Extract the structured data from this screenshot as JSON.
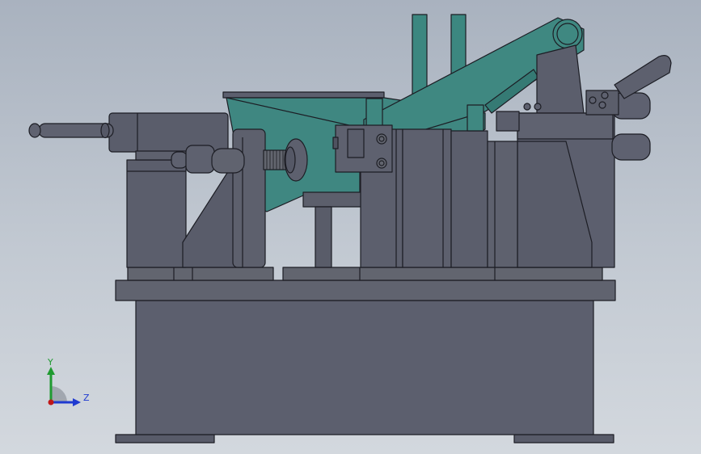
{
  "viewport": {
    "background_top": "#a9b2bf",
    "background_bottom": "#d3d8de",
    "part_color": "#5c5f6e",
    "edge_color": "#1c1d24",
    "accent_color": "#3e8a84"
  },
  "triad": {
    "y_label": "Y",
    "z_label": "Z",
    "y_color": "#1f9a30",
    "z_color": "#1f3ad0",
    "origin_color": "#c01818"
  }
}
